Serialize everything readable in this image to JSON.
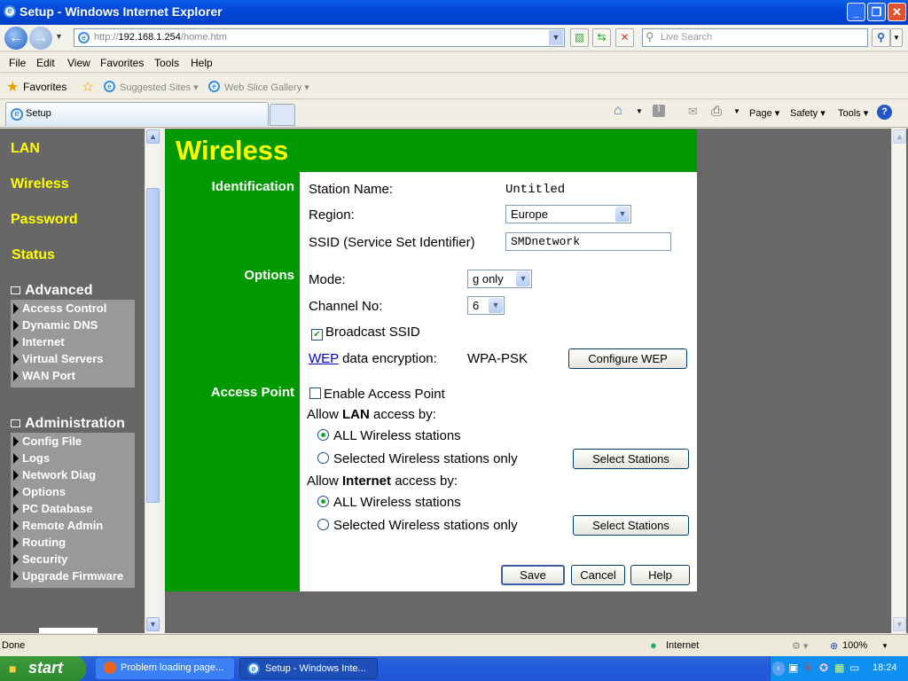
{
  "window": {
    "title": "Setup - Windows Internet Explorer",
    "minimize": "_",
    "restore": "❐",
    "close": "✕"
  },
  "address": {
    "prefix": "http://",
    "host": "192.168.1.254",
    "path": "/home.htm",
    "search_placeholder": "Live Search"
  },
  "menu": [
    "File",
    "Edit",
    "View",
    "Favorites",
    "Tools",
    "Help"
  ],
  "favorites": {
    "label": "Favorites",
    "items": [
      "Suggested Sites ▾",
      "Web Slice Gallery ▾"
    ]
  },
  "tab": {
    "label": "Setup"
  },
  "commandbar": {
    "page": "Page ▾",
    "safety": "Safety ▾",
    "tools": "Tools ▾"
  },
  "sidebar": {
    "links": [
      "LAN",
      "Wireless",
      "Password",
      "Status"
    ],
    "advanced": {
      "title": "Advanced",
      "items": [
        "Access Control",
        "Dynamic DNS",
        "Internet",
        "Virtual Servers",
        "WAN Port"
      ]
    },
    "administration": {
      "title": "Administration",
      "items": [
        "Config File",
        "Logs",
        "Network Diag",
        "Options",
        "PC Database",
        "Remote Admin",
        "Routing",
        "Security",
        "Upgrade Firmware"
      ]
    }
  },
  "page": {
    "title": "Wireless",
    "sections": {
      "identification": "Identification",
      "options": "Options",
      "access_point": "Access Point"
    },
    "station_name_label": "Station Name:",
    "station_name": "Untitled",
    "region_label": "Region:",
    "region": "Europe",
    "ssid_label": "SSID (Service Set Identifier)",
    "ssid": "SMDnetwork",
    "mode_label": "Mode:",
    "mode": "g only",
    "channel_label": "Channel No:",
    "channel": "6",
    "broadcast_ssid": "Broadcast SSID",
    "broadcast_ssid_checked": true,
    "wep_link": "WEP",
    "encryption_label": "data encryption:",
    "encryption": "WPA-PSK",
    "configure_wep": "Configure WEP",
    "enable_ap": "Enable Access Point",
    "enable_ap_checked": false,
    "allow_lan_pre": "Allow ",
    "allow_lan_bold": "LAN",
    "allow_lan_post": " access by:",
    "allow_inet_pre": "Allow ",
    "allow_inet_bold": "Internet",
    "allow_inet_post": " access by:",
    "all_stations": "ALL Wireless stations",
    "selected_only": "Selected Wireless stations only",
    "select_stations": "Select Stations",
    "save": "Save",
    "cancel": "Cancel",
    "help": "Help"
  },
  "statusbar": {
    "text": "Done",
    "zone": "Internet",
    "zoom": "100%"
  },
  "taskbar": {
    "start": "start",
    "tasks": [
      "Problem loading page...",
      "Setup - Windows Inte..."
    ],
    "clock": "18:24"
  }
}
